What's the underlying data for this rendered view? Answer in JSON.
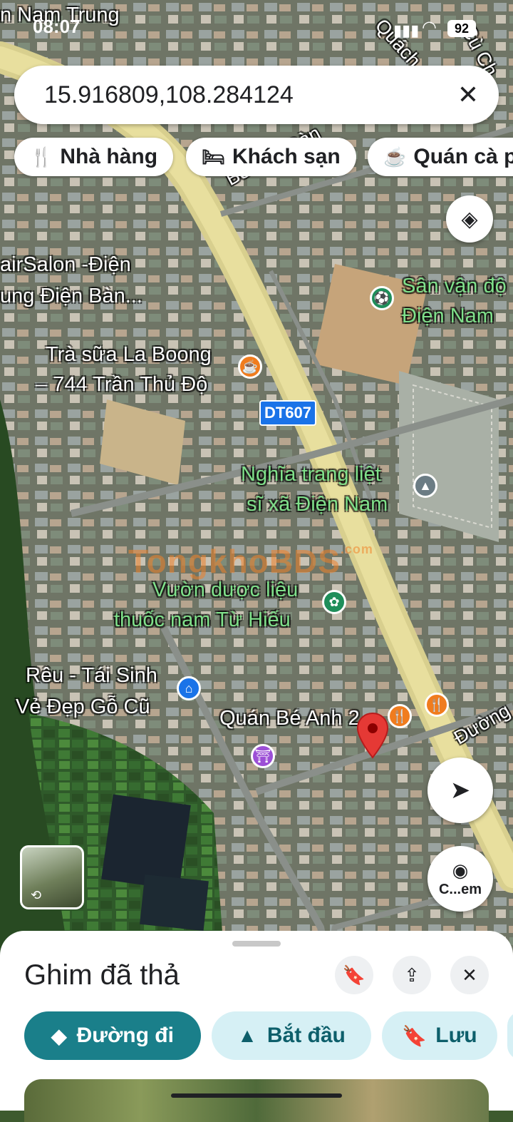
{
  "status_bar": {
    "time": "08:07",
    "battery": "92"
  },
  "search": {
    "query": "15.916809,108.284124"
  },
  "chips": [
    {
      "label": "Nhà hàng",
      "icon": "fork-knife-icon"
    },
    {
      "label": "Khách sạn",
      "icon": "bed-icon"
    },
    {
      "label": "Quán cà p",
      "icon": "coffee-cup-icon"
    }
  ],
  "map": {
    "road_labels": [
      "Bế Văn Đàn",
      "DT607",
      "Đường",
      "Cù Ch",
      "Quách"
    ],
    "place_labels": [
      "n Nam Trung",
      "airSalon -Điện",
      "ung Điện Bàn...",
      "Trà sữa La Boong",
      "– 744 Trần Thủ Độ",
      "Sân vận độ",
      "Điện Nam",
      "Nghĩa trang liệt",
      "sĩ xã Điện Nam",
      "Vườn dược liệu",
      "thuốc nam Từ Hiếu",
      "Rêu - Tái Sinh",
      "Vẻ Đẹp Gỗ Cũ",
      "Quán Bé Anh 2"
    ],
    "watermark": "TongkhoBDS",
    "watermark_suffix": ".com"
  },
  "camera_button": {
    "label": "C...em"
  },
  "sheet": {
    "title": "Ghim đã thả",
    "buttons": {
      "directions": "Đường đi",
      "start": "Bắt đầu",
      "save": "Lưu"
    }
  },
  "colors": {
    "accent": "#1a7f8a",
    "pill_light": "#d6f0f5",
    "road": "#d8cf8e",
    "pin": "#e53935",
    "poi_orange": "#f07c1e",
    "poi_green": "#1e8e5a",
    "poi_purple": "#9c4fd6",
    "poi_blue": "#1a73e8",
    "poi_gray": "#6b7c84"
  }
}
